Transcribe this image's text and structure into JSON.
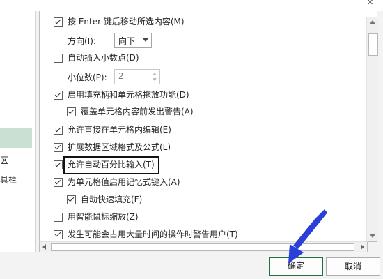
{
  "sidebar": {
    "items": [
      {
        "label": "区"
      },
      {
        "label": "具栏"
      }
    ]
  },
  "options": {
    "move_after_enter": {
      "label": "按 Enter 键后移动所选内容(M)",
      "checked": true
    },
    "direction": {
      "label": "方向(I):",
      "value": "向下"
    },
    "fixed_decimal": {
      "label": "自动插入小数点(D)",
      "checked": false
    },
    "places": {
      "label": "小位数(P):",
      "value": "2"
    },
    "fill_handle": {
      "label": "启用填充柄和单元格拖放功能(D)",
      "checked": true
    },
    "overwrite_alert": {
      "label": "覆盖单元格内容前发出警告(A)",
      "checked": true
    },
    "edit_in_cell": {
      "label": "允许直接在单元格内编辑(E)",
      "checked": true
    },
    "extend_formats": {
      "label": "扩展数据区域格式及公式(L)",
      "checked": true
    },
    "auto_percent": {
      "label": "允许自动百分比输入(T)",
      "checked": true
    },
    "autocomplete": {
      "label": "为单元格值启用记忆式键入(A)",
      "checked": true
    },
    "flash_fill": {
      "label": "自动快速填充(F)",
      "checked": true
    },
    "zoom_intellimouse": {
      "label": "用智能鼠标缩放(Z)",
      "checked": false
    },
    "alert_time_consuming": {
      "label": "发生可能会占用大量时间的操作时警告用户(T)",
      "checked": true
    }
  },
  "buttons": {
    "ok": "确定",
    "cancel": "取消"
  },
  "colors": {
    "accent": "#217346",
    "arrow": "#2a3fd8"
  }
}
